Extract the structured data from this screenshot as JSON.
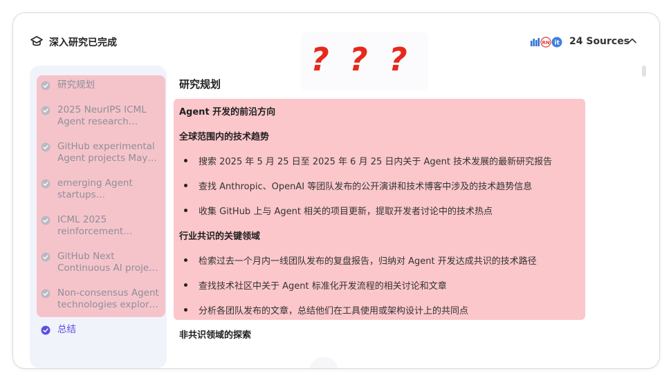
{
  "header": {
    "title": "深入研究已完成",
    "sources_count": "24 Sources",
    "icons": [
      "graduation-cap-icon",
      "source-logos-icon",
      "chevron-up-icon"
    ]
  },
  "overlay": {
    "marks": [
      "?",
      "?",
      "?"
    ],
    "color": "#e8281b"
  },
  "sidebar": {
    "items": [
      {
        "label": "研究规划",
        "state": "done"
      },
      {
        "label": "2025 NeurIPS ICML Agent research…",
        "state": "done"
      },
      {
        "label": "GitHub experimental Agent projects May…",
        "state": "done"
      },
      {
        "label": "emerging Agent startups…",
        "state": "done"
      },
      {
        "label": "ICML 2025 reinforcement…",
        "state": "done"
      },
      {
        "label": "GitHub Next Continuous AI proje…",
        "state": "done"
      },
      {
        "label": "Non-consensus Agent technologies explor…",
        "state": "done"
      },
      {
        "label": "总结",
        "state": "active"
      }
    ],
    "highlight_color": "#f5c4ca",
    "active_color": "#5b4fdf"
  },
  "content": {
    "heading": "研究规划",
    "section_title": "Agent 开发的前沿方向",
    "groups": [
      {
        "title": "全球范围内的技术趋势",
        "bullets": [
          "搜索 2025 年 5 月 25 日至 2025 年 6 月 25 日内关于 Agent 技术发展的最新研究报告",
          "查找 Anthropic、OpenAI 等团队发布的公开演讲和技术博客中涉及的技术趋势信息",
          "收集 GitHub 上与 Agent 相关的项目更新，提取开发者讨论中的技术热点"
        ]
      },
      {
        "title": "行业共识的关键领域",
        "bullets": [
          "检索过去一个月内一线团队发布的复盘报告，归纳对 Agent 开发达成共识的技术路径",
          "查找技术社区中关于 Agent 标准化开发流程的相关讨论和文章",
          "分析各团队发布的文章，总结他们在工具使用或架构设计上的共同点"
        ]
      }
    ],
    "next_section": "非共识领域的探索",
    "highlight_color": "#fbc7cb"
  }
}
